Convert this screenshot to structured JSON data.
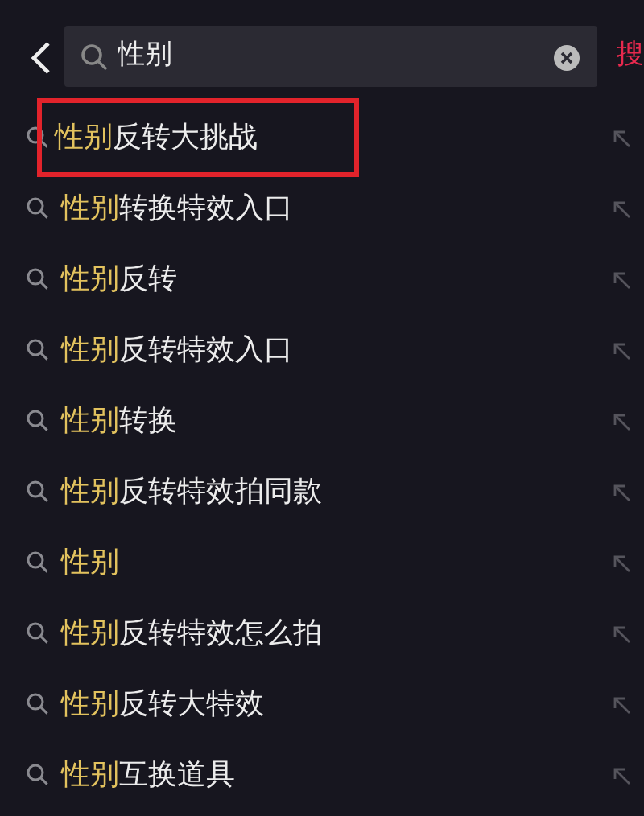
{
  "search": {
    "value": "性别",
    "button": "搜"
  },
  "suggestions": [
    {
      "match": "性别",
      "rest": "反转大挑战",
      "highlighted": true
    },
    {
      "match": "性别",
      "rest": "转换特效入口",
      "highlighted": false
    },
    {
      "match": "性别",
      "rest": "反转",
      "highlighted": false
    },
    {
      "match": "性别",
      "rest": "反转特效入口",
      "highlighted": false
    },
    {
      "match": "性别",
      "rest": "转换",
      "highlighted": false
    },
    {
      "match": "性别",
      "rest": "反转特效拍同款",
      "highlighted": false
    },
    {
      "match": "性别",
      "highlighted": false
    },
    {
      "match": "性别",
      "rest": "反转特效怎么拍",
      "highlighted": false
    },
    {
      "match": "性别",
      "rest": "反转大特效",
      "highlighted": false
    },
    {
      "match": "性别",
      "rest": "互换道具",
      "highlighted": false
    }
  ]
}
